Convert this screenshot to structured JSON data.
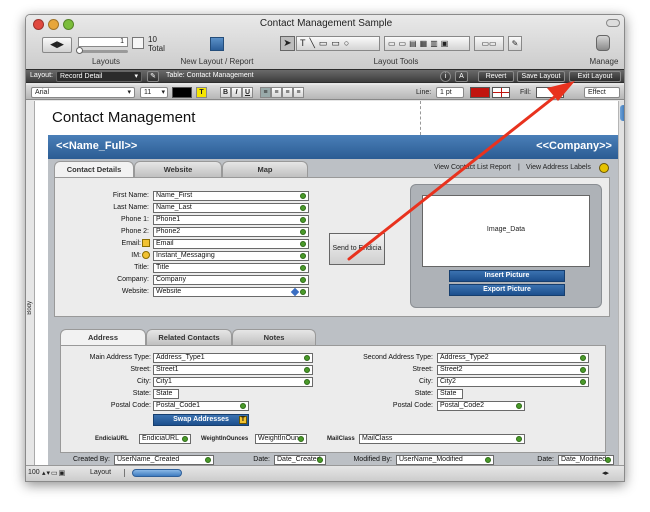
{
  "window": {
    "title": "Contact Management Sample"
  },
  "toolbar": {
    "record_value": "1",
    "total_count": "10",
    "total_label": "Total",
    "layouts_label": "Layouts",
    "new_layout_label": "New Layout / Report",
    "layout_tools_label": "Layout Tools",
    "manage_label": "Manage"
  },
  "layout_bar": {
    "layout_label": "Layout:",
    "layout_value": "Record Detail",
    "table_label": "Table: Contact Management",
    "revert_label": "Revert",
    "save_label": "Save Layout",
    "exit_label": "Exit Layout"
  },
  "format_bar": {
    "font": "Arial",
    "size": "11",
    "line_label": "Line:",
    "line_value": "1 pt",
    "fill_label": "Fill:",
    "effect_label": "Effect",
    "bold": "B",
    "italic": "I",
    "underline": "U",
    "text_t": "T"
  },
  "layout": {
    "title": "Contact Management",
    "name_full": "<<Name_Full>>",
    "company": "<<Company>>",
    "body_part_label": "Body",
    "top_tabs": [
      "Contact Details",
      "Website",
      "Map"
    ],
    "top_links": {
      "view_contact": "View Contact List Report",
      "separator": "|",
      "view_labels": "View Address Labels"
    },
    "fields": [
      {
        "label": "First Name:",
        "value": "Name_First"
      },
      {
        "label": "Last Name:",
        "value": "Name_Last"
      },
      {
        "label": "Phone 1:",
        "value": "Phone1"
      },
      {
        "label": "Phone 2:",
        "value": "Phone2"
      },
      {
        "label": "Email:",
        "value": "Email"
      },
      {
        "label": "IM:",
        "value": "Instant_Messaging"
      },
      {
        "label": "Title:",
        "value": "Title"
      },
      {
        "label": "Company:",
        "value": "Company"
      },
      {
        "label": "Website:",
        "value": "Website"
      }
    ],
    "send_button": "Send to Endicia",
    "image_data": "Image_Data",
    "insert_picture": "Insert Picture",
    "export_picture": "Export Picture",
    "bottom_tabs": [
      "Address",
      "Related Contacts",
      "Notes"
    ],
    "address_left": [
      {
        "label": "Main Address Type:",
        "value": "Address_Type1"
      },
      {
        "label": "Street:",
        "value": "Street1"
      },
      {
        "label": "City:",
        "value": "City1"
      },
      {
        "label": "State:",
        "value": "State"
      },
      {
        "label": "Postal Code:",
        "value": "Postal_Code1"
      }
    ],
    "address_right": [
      {
        "label": "Second Address Type:",
        "value": "Address_Type2"
      },
      {
        "label": "Street:",
        "value": "Street2"
      },
      {
        "label": "City:",
        "value": "City2"
      },
      {
        "label": "State:",
        "value": "State"
      },
      {
        "label": "Postal Code:",
        "value": "Postal_Code2"
      }
    ],
    "swap_addresses": "Swap Addresses",
    "endicia_label": "EndiciaURL",
    "endicia_value": "EndiciaURL",
    "weight_label": "WeightInOunces",
    "weight_value": "WeightInOun",
    "mailclass_label": "MailClass",
    "mailclass_value": "MailClass",
    "footer": {
      "created_by_label": "Created By:",
      "created_by_value": "UserName_Created",
      "date1_label": "Date:",
      "date1_value": "Date_Created",
      "modified_by_label": "Modified By:",
      "modified_by_value": "UserName_Modified",
      "date2_label": "Date:",
      "date2_value": "Date_Modified"
    }
  },
  "status_bar": {
    "zoom": "100",
    "mode": "Layout"
  },
  "colors": {
    "accent": "#2b5c93",
    "arrow": "#e8321e",
    "field_dot": "#4a9a2a"
  }
}
